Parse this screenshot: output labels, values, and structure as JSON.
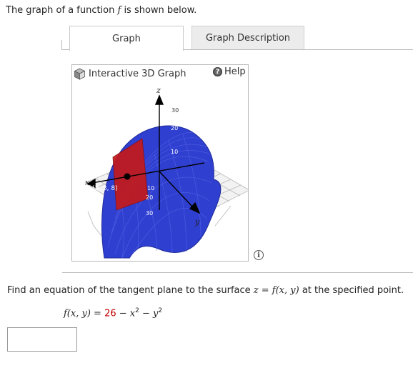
{
  "intro": {
    "before": "The graph of a function ",
    "var": "f",
    "after": " is shown below."
  },
  "tabs": [
    {
      "label": "Graph",
      "active": true
    },
    {
      "label": "Graph Description",
      "active": false
    }
  ],
  "graph_panel": {
    "title": "Interactive 3D Graph",
    "help_label": "Help",
    "axis_labels": {
      "x": "x",
      "y": "y",
      "z": "z"
    },
    "z_ticks": [
      "30",
      "20",
      "10",
      "10",
      "20",
      "30"
    ],
    "point_label": "(3, 3, 8)",
    "colors": {
      "surface": "#2f3fd0",
      "tangent_plane": "#c41a1a",
      "point": "#000000"
    }
  },
  "question": {
    "before": "Find an equation of the tangent plane to the surface ",
    "equation": "z = f(x, y)",
    "after": " at the specified point."
  },
  "formula": {
    "lhs": "f(x, y) = ",
    "constant": "26",
    "rest": " − x",
    "exp1": "2",
    "middle": " − y",
    "exp2": "2"
  },
  "answer": {
    "value": ""
  }
}
